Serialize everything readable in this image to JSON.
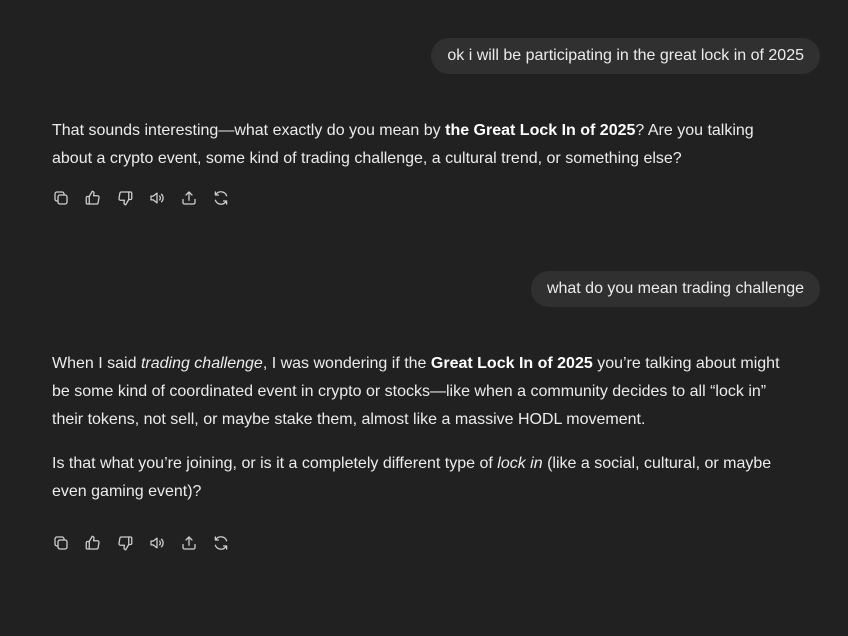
{
  "messages": [
    {
      "role": "user",
      "text": "ok i will be participating in the great lock in of 2025"
    },
    {
      "role": "assistant",
      "paragraphs": [
        [
          {
            "t": "That sounds interesting—what exactly do you mean by "
          },
          {
            "t": "the Great Lock In of 2025",
            "style": "bold"
          },
          {
            "t": "? Are you talking about a crypto event, some kind of trading challenge, a cultural trend, or something else?"
          }
        ]
      ]
    },
    {
      "role": "user",
      "text": "what do you mean trading challenge"
    },
    {
      "role": "assistant",
      "paragraphs": [
        [
          {
            "t": "When I said "
          },
          {
            "t": "trading challenge",
            "style": "italic"
          },
          {
            "t": ", I was wondering if the "
          },
          {
            "t": "Great Lock In of 2025",
            "style": "bold"
          },
          {
            "t": " you’re talking about might be some kind of coordinated event in crypto or stocks—like when a community decides to all “lock in” their tokens, not sell, or maybe stake them, almost like a massive HODL movement."
          }
        ],
        [
          {
            "t": "Is that what you’re joining, or is it a completely different type of "
          },
          {
            "t": "lock in",
            "style": "italic"
          },
          {
            "t": " (like a social, cultural, or maybe even gaming event)?"
          }
        ]
      ]
    }
  ],
  "action_icons": [
    "copy-icon",
    "thumbs-up-icon",
    "thumbs-down-icon",
    "read-aloud-icon",
    "share-icon",
    "regenerate-icon"
  ],
  "colors": {
    "background": "#212121",
    "user_bubble": "#303030",
    "text": "#ececec",
    "icon": "#d0d0d0"
  }
}
